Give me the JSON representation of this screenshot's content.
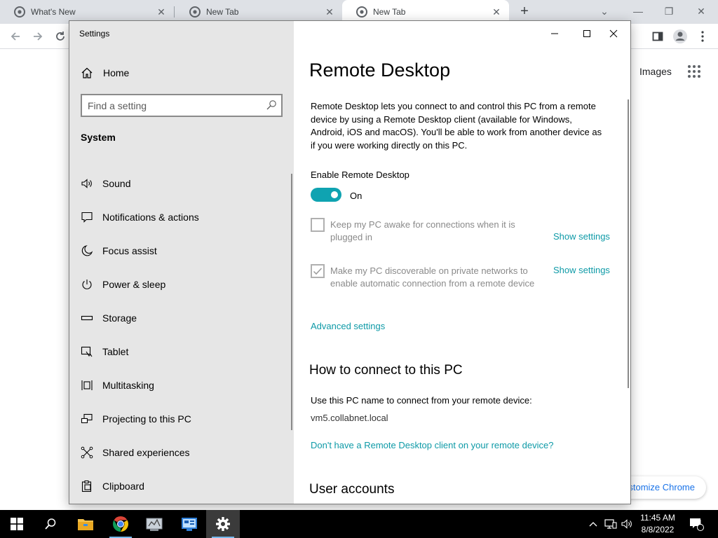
{
  "browser": {
    "tabs": [
      {
        "title": "What's New"
      },
      {
        "title": "New Tab"
      },
      {
        "title": "New Tab"
      }
    ],
    "new_tab_icon": "plus-icon",
    "ntp": {
      "images_link": "Images",
      "customize_button": "Customize Chrome"
    }
  },
  "settings": {
    "window_title": "Settings",
    "sidebar": {
      "home_label": "Home",
      "search_placeholder": "Find a setting",
      "section_heading": "System",
      "items": [
        {
          "label": "Sound",
          "icon": "speaker-icon"
        },
        {
          "label": "Notifications & actions",
          "icon": "notifications-icon"
        },
        {
          "label": "Focus assist",
          "icon": "moon-icon"
        },
        {
          "label": "Power & sleep",
          "icon": "power-icon"
        },
        {
          "label": "Storage",
          "icon": "storage-icon"
        },
        {
          "label": "Tablet",
          "icon": "tablet-icon"
        },
        {
          "label": "Multitasking",
          "icon": "multitasking-icon"
        },
        {
          "label": "Projecting to this PC",
          "icon": "projecting-icon"
        },
        {
          "label": "Shared experiences",
          "icon": "shared-experiences-icon"
        },
        {
          "label": "Clipboard",
          "icon": "clipboard-icon"
        }
      ]
    },
    "content": {
      "title": "Remote Desktop",
      "description": "Remote Desktop lets you connect to and control this PC from a remote device by using a Remote Desktop client (available for Windows, Android, iOS and macOS). You'll be able to work from another device as if you were working directly on this PC.",
      "enable_label": "Enable Remote Desktop",
      "toggle_state": "On",
      "toggle_on": true,
      "options": [
        {
          "label": "Keep my PC awake for connections when it is plugged in",
          "checked": false,
          "link": "Show settings"
        },
        {
          "label": "Make my PC discoverable on private networks to enable automatic connection from a remote device",
          "checked": true,
          "link": "Show settings"
        }
      ],
      "advanced_link": "Advanced settings",
      "connect_heading": "How to connect to this PC",
      "connect_text": "Use this PC name to connect from your remote device:",
      "pc_name": "vm5.collabnet.local",
      "client_link": "Don't have a Remote Desktop client on your remote device?",
      "user_accounts_heading": "User accounts"
    }
  },
  "taskbar": {
    "time": "11:45 AM",
    "date": "8/8/2022",
    "notification_count": "1"
  },
  "colors": {
    "accent": "#0fa3b1",
    "link": "#0e9aa7",
    "sidebar_bg": "#e6e6e6",
    "taskbar_bg": "#000000"
  }
}
